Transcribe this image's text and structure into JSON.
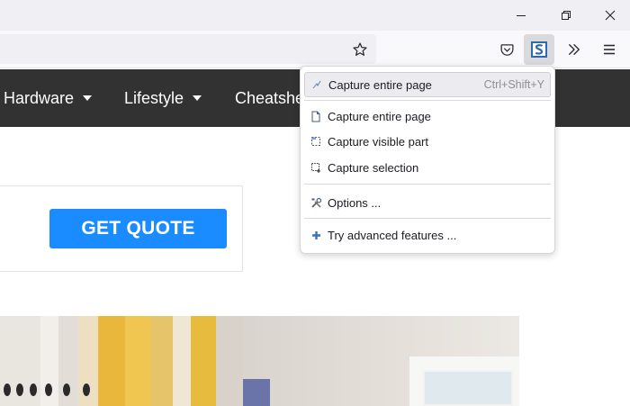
{
  "window": {
    "minimize_icon": "minimize-icon",
    "restore_icon": "restore-icon",
    "close_icon": "close-icon"
  },
  "toolbar": {
    "star_icon": "star-icon",
    "pocket_icon": "pocket-icon",
    "screenshot_icon": "screenshot-extension-icon",
    "overflow_icon": "chevron-double-right-icon",
    "menu_icon": "hamburger-icon"
  },
  "site_nav": {
    "items": [
      {
        "label": "Hardware"
      },
      {
        "label": "Lifestyle"
      },
      {
        "label": "Cheatshe"
      }
    ]
  },
  "content": {
    "cta_label": "GET QUOTE"
  },
  "menu": {
    "items": [
      {
        "label": "Capture entire page",
        "shortcut": "Ctrl+Shift+Y",
        "icon": "capture-quick-icon"
      },
      {
        "label": "Capture entire page",
        "icon": "page-icon"
      },
      {
        "label": "Capture visible part",
        "icon": "visible-part-icon"
      },
      {
        "label": "Capture selection",
        "icon": "selection-icon"
      },
      {
        "label": "Options ...",
        "icon": "tools-icon"
      },
      {
        "label": "Try advanced features ...",
        "icon": "plus-icon"
      }
    ]
  },
  "colors": {
    "nav_bg": "#323232",
    "cta_bg": "#1a8cff",
    "menu_highlight": "#ececf0"
  }
}
